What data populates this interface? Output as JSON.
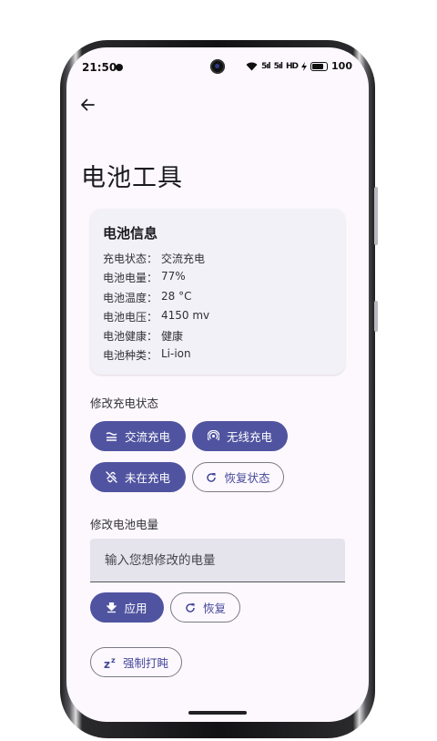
{
  "status_bar": {
    "time": "21:50",
    "signal_1": "5ıl",
    "signal_2": "5ıl",
    "hd_label": "HD",
    "battery_level": "100"
  },
  "header": {
    "title": "电池工具"
  },
  "battery_info": {
    "title": "电池信息",
    "rows": [
      {
        "label": "充电状态：",
        "value": "交流充电"
      },
      {
        "label": "电池电量：",
        "value": "77%"
      },
      {
        "label": "电池温度：",
        "value": "28 °C"
      },
      {
        "label": "电池电压：",
        "value": "4150 mv"
      },
      {
        "label": "电池健康：",
        "value": "健康"
      },
      {
        "label": "电池种类：",
        "value": "Li-ion"
      }
    ]
  },
  "charge_state": {
    "label": "修改充电状态",
    "ac_button": "交流充电",
    "wireless_button": "无线充电",
    "not_charging_button": "未在充电",
    "restore_button": "恢复状态"
  },
  "battery_level": {
    "label": "修改电池电量",
    "input_placeholder": "输入您想修改的电量",
    "apply_button": "应用",
    "restore_button": "恢复"
  },
  "doze": {
    "button": "强制打盹"
  },
  "colors": {
    "accent": "#5054a0",
    "background": "#fdf8fd",
    "card": "#f2f1f7"
  }
}
